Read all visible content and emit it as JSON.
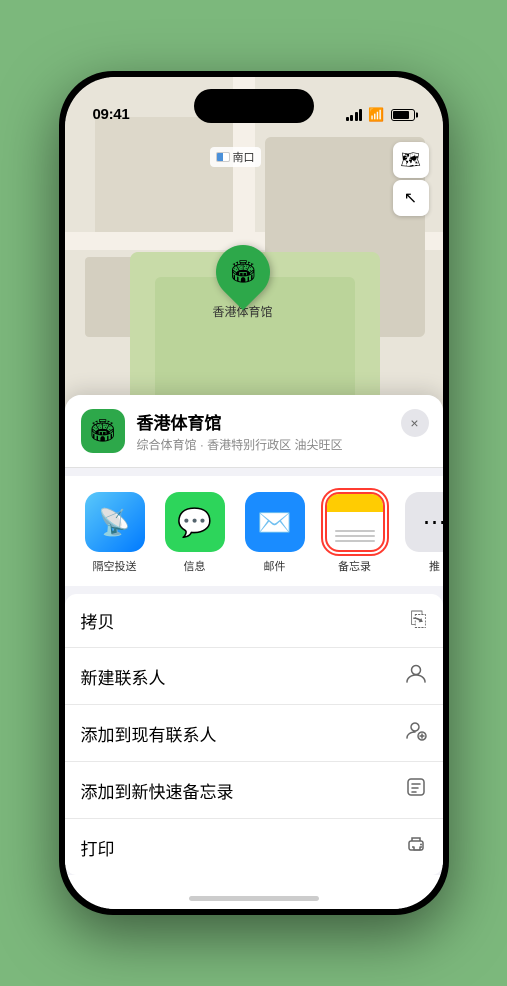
{
  "status_bar": {
    "time": "09:41",
    "location_icon": "▶"
  },
  "map": {
    "north_label": "南口",
    "pin_emoji": "🏟",
    "pin_label": "香港体育馆",
    "map_icon": "🗺",
    "compass_icon": "⬆"
  },
  "location_header": {
    "avatar_emoji": "🏟",
    "name": "香港体育馆",
    "subtitle": "综合体育馆 · 香港特别行政区 油尖旺区",
    "close_label": "×"
  },
  "share_items": [
    {
      "id": "airdrop",
      "label": "隔空投送",
      "type": "airdrop"
    },
    {
      "id": "messages",
      "label": "信息",
      "type": "messages"
    },
    {
      "id": "mail",
      "label": "邮件",
      "type": "mail"
    },
    {
      "id": "notes",
      "label": "备忘录",
      "type": "notes",
      "selected": true
    },
    {
      "id": "more",
      "label": "推",
      "type": "more"
    }
  ],
  "action_items": [
    {
      "id": "copy",
      "text": "拷贝",
      "icon": "⎘"
    },
    {
      "id": "new-contact",
      "text": "新建联系人",
      "icon": "👤"
    },
    {
      "id": "add-existing",
      "text": "添加到现有联系人",
      "icon": "👤"
    },
    {
      "id": "add-notes",
      "text": "添加到新快速备忘录",
      "icon": "📋"
    },
    {
      "id": "print",
      "text": "打印",
      "icon": "🖨"
    }
  ]
}
